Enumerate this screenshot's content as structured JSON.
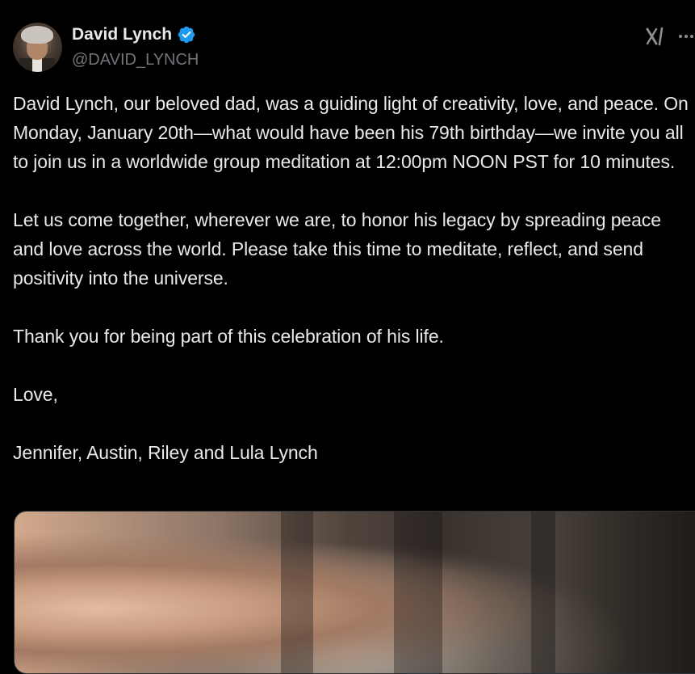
{
  "author": {
    "display_name": "David Lynch",
    "handle": "@DAVID_LYNCH",
    "verified": true
  },
  "icons": {
    "avatar": "avatar-photo",
    "verified": "verified-badge-icon",
    "grok": "grok-icon",
    "more": "more-options-icon"
  },
  "colors": {
    "background": "#000000",
    "text": "#e7e9ea",
    "secondary_text": "#71767b",
    "verified_blue": "#1d9bf0"
  },
  "tweet": {
    "paragraphs": [
      "David Lynch, our beloved dad, was a guiding light of creativity, love, and peace. On Monday, January 20th—what would have been his 79th birthday—we invite you all to join us in a worldwide group meditation at 12:00pm NOON PST for 10 minutes.",
      "Let us come together, wherever we are, to honor his legacy by spreading peace and love across the world. Please take this time to meditate, reflect, and send positivity into the universe.",
      "Thank you for being part of this celebration of his life.",
      "Love,",
      "Jennifer, Austin, Riley and Lula Lynch"
    ]
  },
  "media": {
    "type": "photo"
  }
}
